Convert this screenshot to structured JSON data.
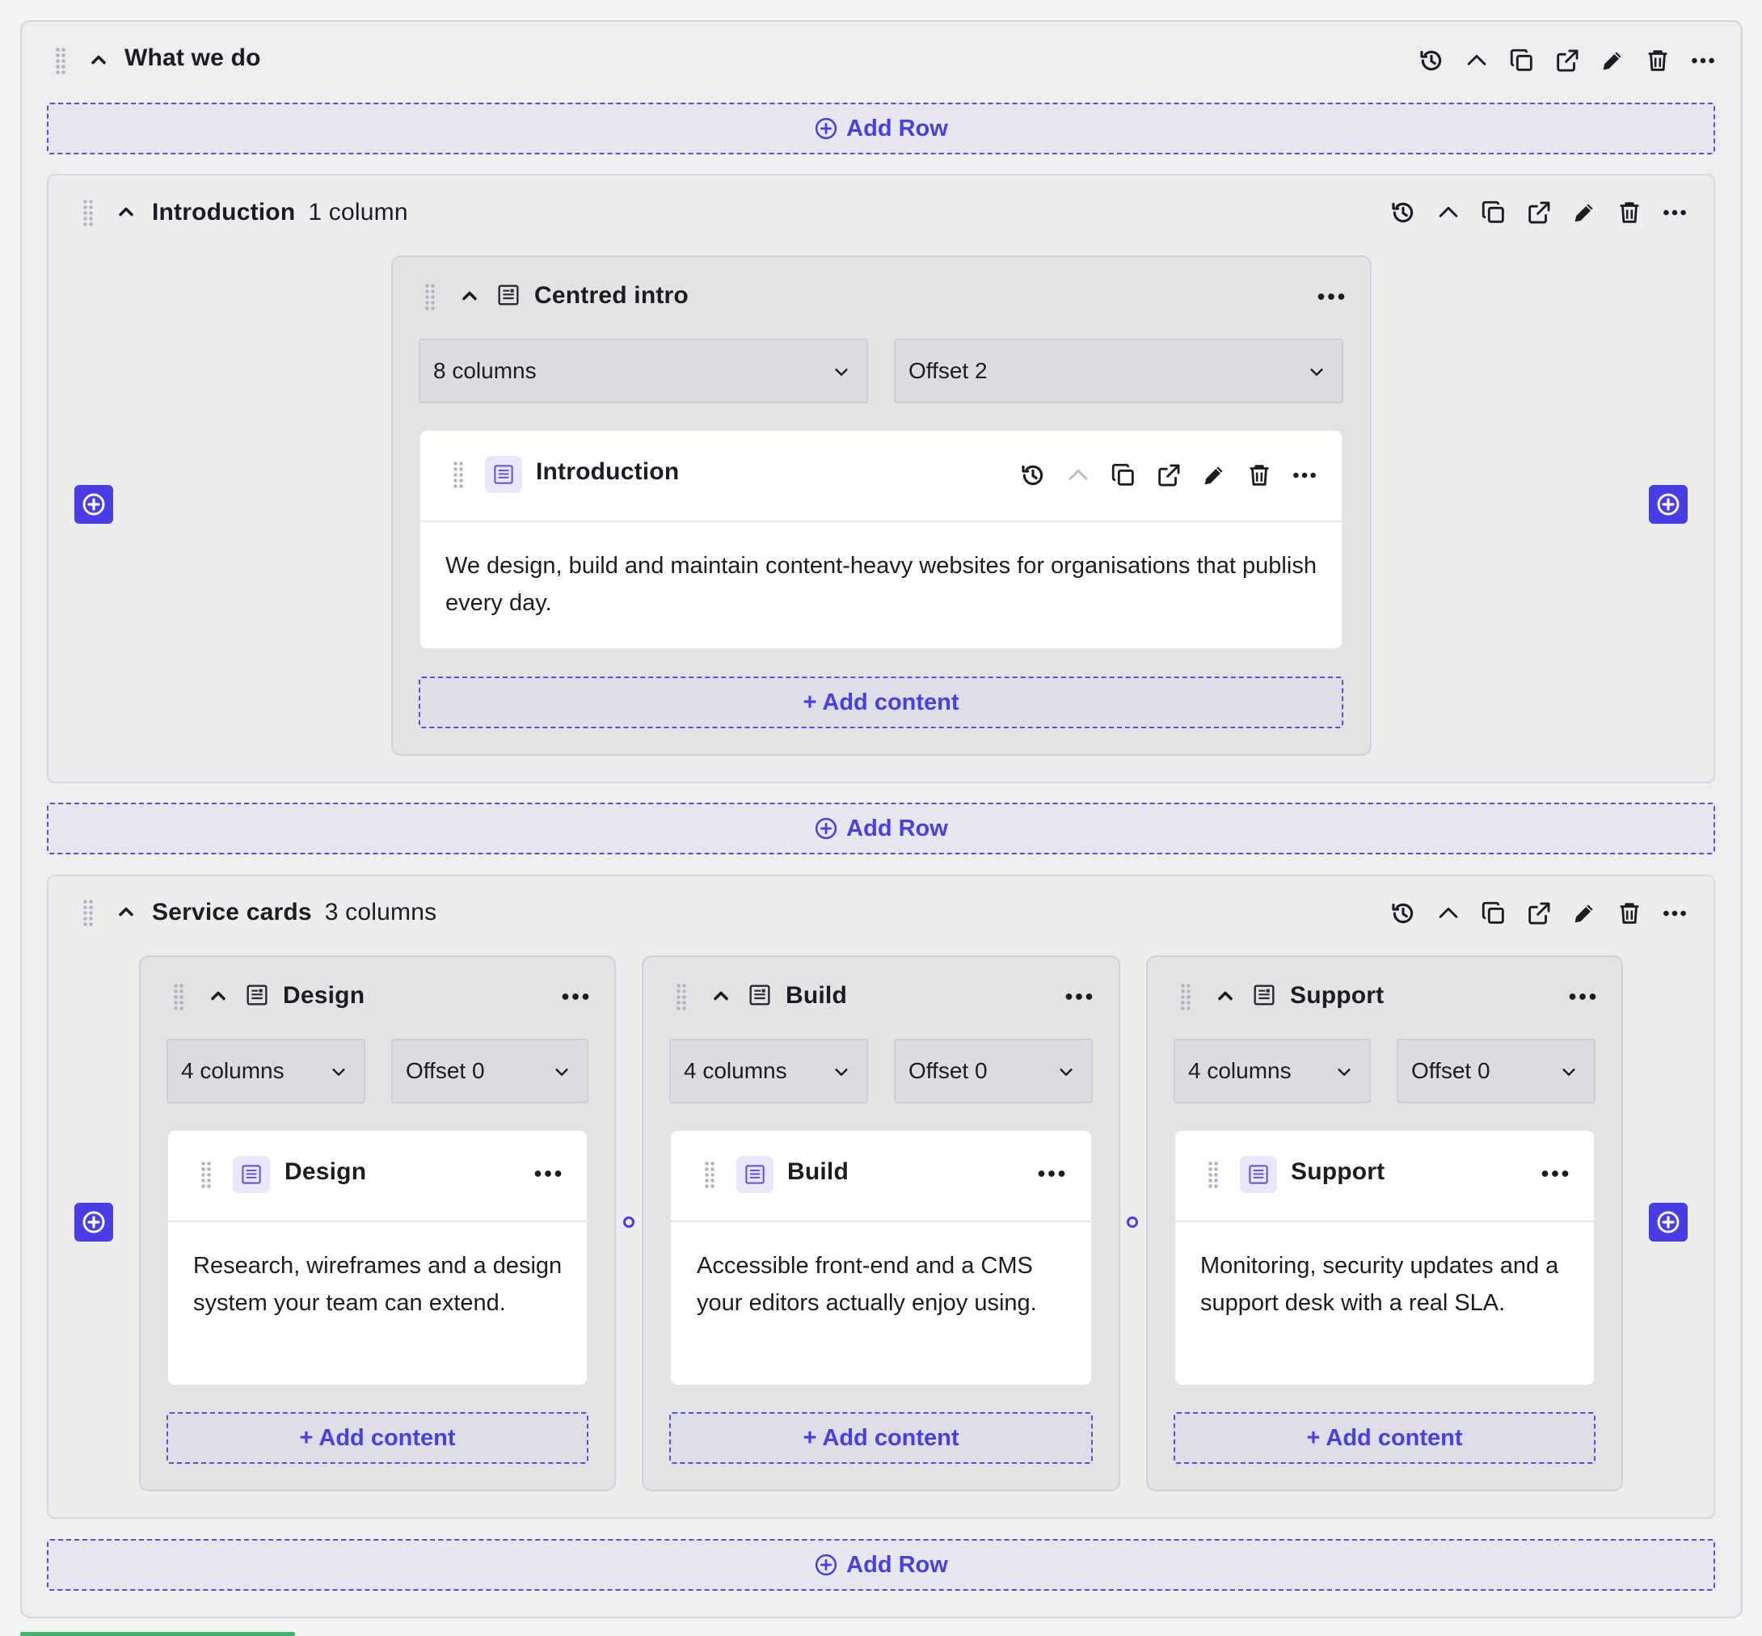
{
  "section": {
    "title": "What we do"
  },
  "add_row_label": "Add Row",
  "add_content_label": "+ Add content",
  "rows": [
    {
      "title": "Introduction",
      "meta": "1 column",
      "columns": [
        {
          "title": "Centred intro",
          "width": "8 columns",
          "offset": "Offset 2",
          "block": {
            "title": "Introduction",
            "text": "We design, build and maintain content-heavy websites for organisations that publish every day."
          }
        }
      ]
    },
    {
      "title": "Service cards",
      "meta": "3 columns",
      "columns": [
        {
          "title": "Design",
          "width": "4 columns",
          "offset": "Offset 0",
          "block": {
            "title": "Design",
            "text": "Research, wireframes and a design system your team can extend."
          }
        },
        {
          "title": "Build",
          "width": "4 columns",
          "offset": "Offset 0",
          "block": {
            "title": "Build",
            "text": "Accessible front-end and a CMS your editors actually enjoy using."
          }
        },
        {
          "title": "Support",
          "width": "4 columns",
          "offset": "Offset 0",
          "block": {
            "title": "Support",
            "text": "Monitoring, security updates and a support desk with a real SLA."
          }
        }
      ]
    }
  ],
  "colors": {
    "accent": "#4a3de6",
    "surface": "#eeeef1",
    "card": "#ffffff"
  },
  "icons": [
    "history-icon",
    "collapse-icon",
    "duplicate-icon",
    "open-external-icon",
    "edit-icon",
    "delete-icon",
    "more-icon",
    "drag-handle-icon",
    "chevron-up-icon",
    "chevron-down-icon",
    "document-icon",
    "add-circle-icon"
  ]
}
